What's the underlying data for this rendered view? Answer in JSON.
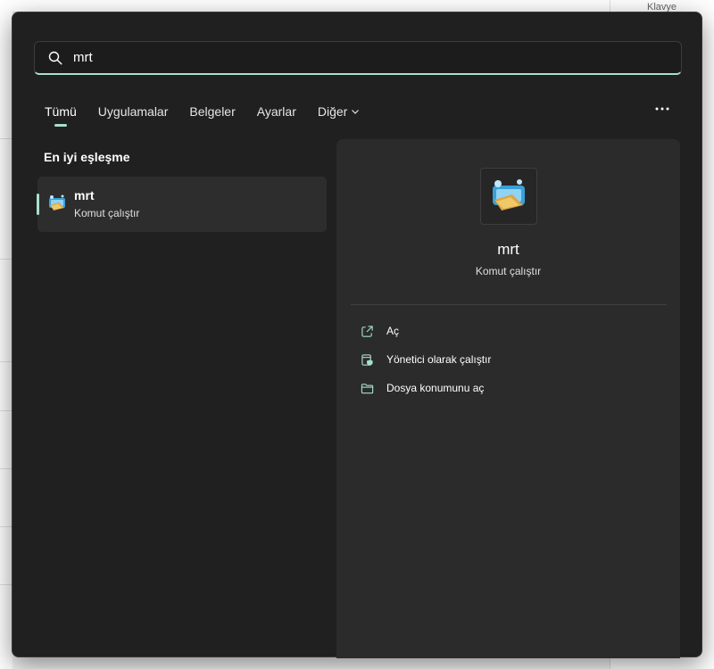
{
  "background": {
    "right_top_text": "Klavye"
  },
  "search": {
    "value": "mrt",
    "placeholder": ""
  },
  "tabs": [
    {
      "label": "Tümü",
      "active": true
    },
    {
      "label": "Uygulamalar",
      "active": false
    },
    {
      "label": "Belgeler",
      "active": false
    },
    {
      "label": "Ayarlar",
      "active": false
    },
    {
      "label": "Diğer",
      "active": false,
      "has_dropdown": true
    }
  ],
  "more_button": {
    "label": "···"
  },
  "best_match": {
    "heading": "En iyi eşleşme",
    "item": {
      "title": "mrt",
      "subtitle": "Komut çalıştır",
      "icon": "malicious-software-removal-tool-icon"
    }
  },
  "detail": {
    "title": "mrt",
    "subtitle": "Komut çalıştır",
    "actions": [
      {
        "label": "Aç",
        "icon": "open-external-icon"
      },
      {
        "label": "Yönetici olarak çalıştır",
        "icon": "admin-shield-icon"
      },
      {
        "label": "Dosya konumunu aç",
        "icon": "folder-icon"
      }
    ]
  },
  "colors": {
    "accent": "#a7e0c9",
    "flyout_bg": "#202020",
    "pane_bg": "#2b2b2b",
    "selected_bg": "#2d2d2d"
  }
}
